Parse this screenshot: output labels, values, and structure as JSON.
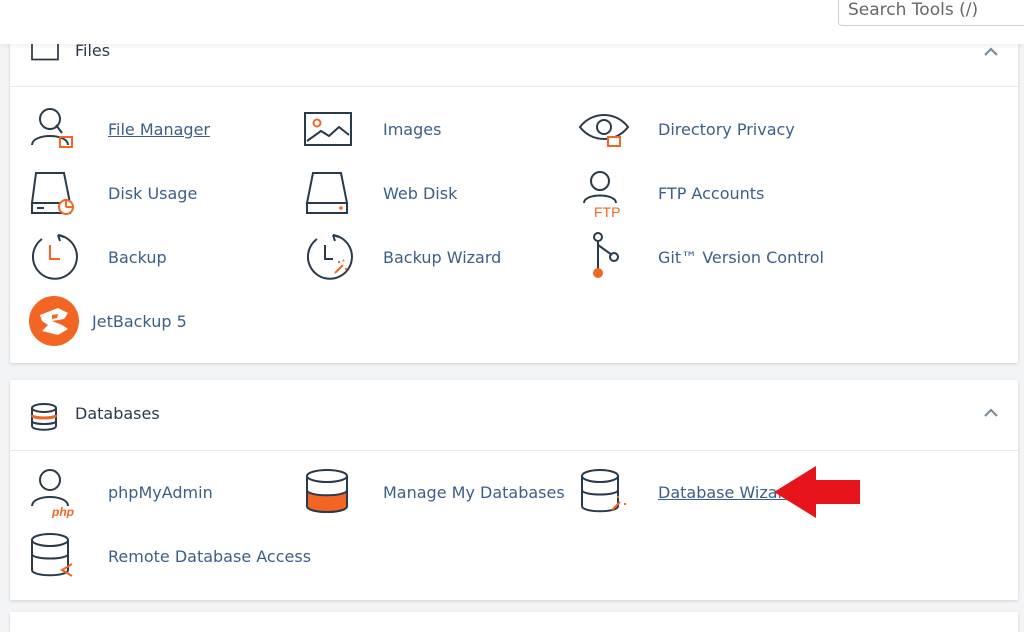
{
  "search": {
    "placeholder": "Search Tools (/)"
  },
  "files": {
    "title": "Files",
    "tools": [
      {
        "label": "File Manager"
      },
      {
        "label": "Images"
      },
      {
        "label": "Directory Privacy"
      },
      {
        "label": "Disk Usage"
      },
      {
        "label": "Web Disk"
      },
      {
        "label": "FTP Accounts"
      },
      {
        "label": "Backup"
      },
      {
        "label": "Backup Wizard"
      },
      {
        "label": "Git™ Version Control"
      },
      {
        "label": "JetBackup 5"
      }
    ]
  },
  "databases": {
    "title": "Databases",
    "tools": [
      {
        "label": "phpMyAdmin"
      },
      {
        "label": "Manage My Databases"
      },
      {
        "label": "Database Wizard"
      },
      {
        "label": "Remote Database Access"
      }
    ]
  },
  "icon_text": {
    "ftp": "FTP",
    "php": "php"
  },
  "colors": {
    "accent": "#f26522",
    "link": "#3b5f8a",
    "arrow": "#e8141c"
  }
}
